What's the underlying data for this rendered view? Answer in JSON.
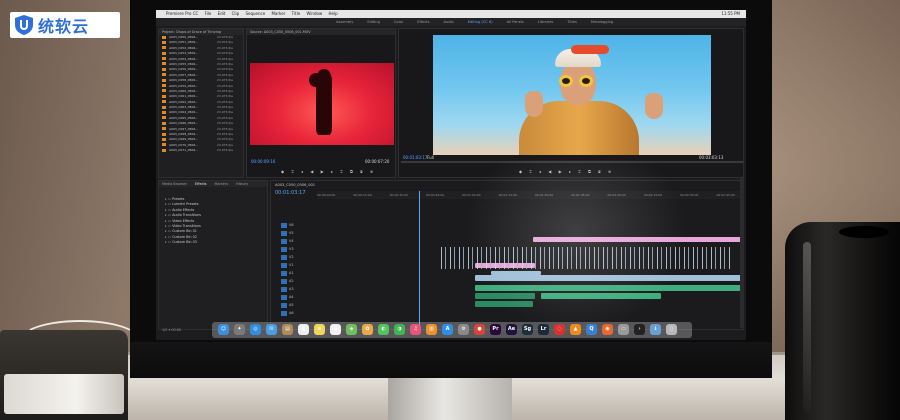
{
  "watermark": {
    "text": "统软云",
    "color": "#2f6fd6"
  },
  "menubar": {
    "items": [
      "Premiere Pro CC",
      "File",
      "Edit",
      "Clip",
      "Sequence",
      "Marker",
      "Title",
      "Window",
      "Help"
    ],
    "status": "11:55 PM"
  },
  "workspace_tabs": [
    {
      "label": "Assembly",
      "active": false
    },
    {
      "label": "Editing",
      "active": false
    },
    {
      "label": "Color",
      "active": false
    },
    {
      "label": "Effects",
      "active": false
    },
    {
      "label": "Audio",
      "active": false
    },
    {
      "label": "Editing (CC 6)",
      "active": true
    },
    {
      "label": "All Panels",
      "active": false
    },
    {
      "label": "Libraries",
      "active": false
    },
    {
      "label": "Titles",
      "active": false
    },
    {
      "label": "Metalogging",
      "active": false
    }
  ],
  "project": {
    "title": "Project: Chops of Grace of Thriving",
    "clips": [
      {
        "name": "A003_C050_0506...",
        "rate": "23.976 fps",
        "color": "#e08b2a"
      },
      {
        "name": "A003_C051_0506...",
        "rate": "23.976 fps",
        "color": "#e08b2a"
      },
      {
        "name": "A003_C052_0506...",
        "rate": "23.976 fps",
        "color": "#e08b2a"
      },
      {
        "name": "A003_C053_0506...",
        "rate": "23.976 fps",
        "color": "#e08b2a"
      },
      {
        "name": "A003_C054_0506...",
        "rate": "23.976 fps",
        "color": "#e08b2a"
      },
      {
        "name": "A003_C055_0506...",
        "rate": "23.976 fps",
        "color": "#e08b2a"
      },
      {
        "name": "A003_C056_0506...",
        "rate": "23.976 fps",
        "color": "#e08b2a"
      },
      {
        "name": "A003_C057_0506...",
        "rate": "23.976 fps",
        "color": "#e08b2a"
      },
      {
        "name": "A003_C058_0506...",
        "rate": "23.976 fps",
        "color": "#e08b2a"
      },
      {
        "name": "A003_C059_0506...",
        "rate": "23.976 fps",
        "color": "#e08b2a"
      },
      {
        "name": "A003_C060_0506...",
        "rate": "23.976 fps",
        "color": "#e08b2a"
      },
      {
        "name": "A003_C061_0506...",
        "rate": "23.976 fps",
        "color": "#e08b2a"
      },
      {
        "name": "A003_C062_0506...",
        "rate": "23.976 fps",
        "color": "#e08b2a"
      },
      {
        "name": "A003_C063_0506...",
        "rate": "23.976 fps",
        "color": "#e08b2a"
      },
      {
        "name": "A003_C064_0506...",
        "rate": "23.976 fps",
        "color": "#e08b2a"
      },
      {
        "name": "A003_C065_0506...",
        "rate": "23.976 fps",
        "color": "#e08b2a"
      },
      {
        "name": "A003_C066_0506...",
        "rate": "23.976 fps",
        "color": "#e08b2a"
      },
      {
        "name": "A003_C067_0506...",
        "rate": "23.976 fps",
        "color": "#e08b2a"
      },
      {
        "name": "A003_C068_0506...",
        "rate": "23.976 fps",
        "color": "#e08b2a"
      },
      {
        "name": "A003_C069_0506...",
        "rate": "23.976 fps",
        "color": "#e08b2a"
      },
      {
        "name": "A003_C070_0506...",
        "rate": "23.976 fps",
        "color": "#e08b2a"
      },
      {
        "name": "A003_C071_0506...",
        "rate": "23.976 fps",
        "color": "#e08b2a"
      }
    ]
  },
  "source": {
    "title": "Source: A003_C050_0506_001.MOV",
    "timecode_in": "00:00:09:16",
    "timecode_out": "00:00:07:20"
  },
  "program": {
    "title": "Program: A003_C050_0506_001",
    "timecode": "00:01:03:17",
    "duration": "00:03:03:13",
    "fit": "Full"
  },
  "effects": {
    "tabs": [
      {
        "label": "Media Browser",
        "active": false
      },
      {
        "label": "Effects",
        "active": true
      },
      {
        "label": "Markers",
        "active": false
      },
      {
        "label": "History",
        "active": false
      }
    ],
    "items": [
      "Presets",
      "Lumetri Presets",
      "Audio Effects",
      "Audio Transitions",
      "Video Effects",
      "Video Transitions",
      "Custom Bin 01",
      "Custom Bin 02",
      "Custom Bin 03"
    ]
  },
  "timeline": {
    "sequence": "A003_C050_0506_001",
    "timecode": "00:01:03:17",
    "ruler": [
      "00:00:00:00",
      "00:00:15:00",
      "00:00:30:00",
      "00:00:45:00",
      "00:01:00:00",
      "00:01:15:00",
      "00:01:30:00",
      "00:01:45:00",
      "00:02:00:00",
      "00:02:15:00",
      "00:02:30:00",
      "00:02:45:00",
      "00:03:00:00"
    ],
    "tracks": [
      "V6",
      "V5",
      "V4",
      "V3",
      "V2",
      "V1",
      "A1",
      "A2",
      "A3",
      "A4",
      "A5",
      "A6"
    ]
  },
  "dock": [
    {
      "name": "finder-icon",
      "glyph": "☺",
      "color": "#3b8fe0"
    },
    {
      "name": "launchpad-icon",
      "glyph": "✦",
      "color": "#7a7a7a"
    },
    {
      "name": "safari-icon",
      "glyph": "◎",
      "color": "#2f8ee0"
    },
    {
      "name": "mail-icon",
      "glyph": "✉",
      "color": "#4a9de0"
    },
    {
      "name": "contacts-icon",
      "glyph": "▤",
      "color": "#b08a5a"
    },
    {
      "name": "calendar-icon",
      "glyph": "▦",
      "color": "#eeeeee"
    },
    {
      "name": "notes-icon",
      "glyph": "≡",
      "color": "#f1d45a"
    },
    {
      "name": "reminders-icon",
      "glyph": "☰",
      "color": "#f0f0f0"
    },
    {
      "name": "maps-icon",
      "glyph": "◈",
      "color": "#6fbf5c"
    },
    {
      "name": "photos-icon",
      "glyph": "✿",
      "color": "#e9a84c"
    },
    {
      "name": "messages-icon",
      "glyph": "◐",
      "color": "#52c45c"
    },
    {
      "name": "facetime-icon",
      "glyph": "◑",
      "color": "#3fb44f"
    },
    {
      "name": "itunes-icon",
      "glyph": "♫",
      "color": "#e8557a"
    },
    {
      "name": "ibooks-icon",
      "glyph": "▥",
      "color": "#e8932f"
    },
    {
      "name": "app-store-icon",
      "glyph": "A",
      "color": "#2e8fe8"
    },
    {
      "name": "preferences-icon",
      "glyph": "⚙",
      "color": "#8a8a8a"
    },
    {
      "name": "chrome-icon",
      "glyph": "●",
      "color": "#d8433a"
    },
    {
      "name": "premiere-icon",
      "glyph": "Pr",
      "color": "#2a0a3a"
    },
    {
      "name": "after-effects-icon",
      "glyph": "Ae",
      "color": "#1e1338"
    },
    {
      "name": "speedgrade-icon",
      "glyph": "Sg",
      "color": "#1d2f3a"
    },
    {
      "name": "lightroom-icon",
      "glyph": "Lr",
      "color": "#1a2a38"
    },
    {
      "name": "creative-cloud-icon",
      "glyph": "◌",
      "color": "#d8322e"
    },
    {
      "name": "vlc-icon",
      "glyph": "▲",
      "color": "#f08a1e"
    },
    {
      "name": "quicktime-icon",
      "glyph": "Q",
      "color": "#3a7fd0"
    },
    {
      "name": "firefox-icon",
      "glyph": "◉",
      "color": "#e8672e"
    },
    {
      "name": "disk-icon",
      "glyph": "▭",
      "color": "#9a9a9a"
    },
    {
      "name": "terminal-icon",
      "glyph": "›",
      "color": "#222222"
    },
    {
      "name": "downloads-icon",
      "glyph": "↓",
      "color": "#6aa0d8"
    },
    {
      "name": "trash-icon",
      "glyph": "▯",
      "color": "#b8b8b8"
    }
  ],
  "status_bottom": "1/2 ▾ 00:00"
}
